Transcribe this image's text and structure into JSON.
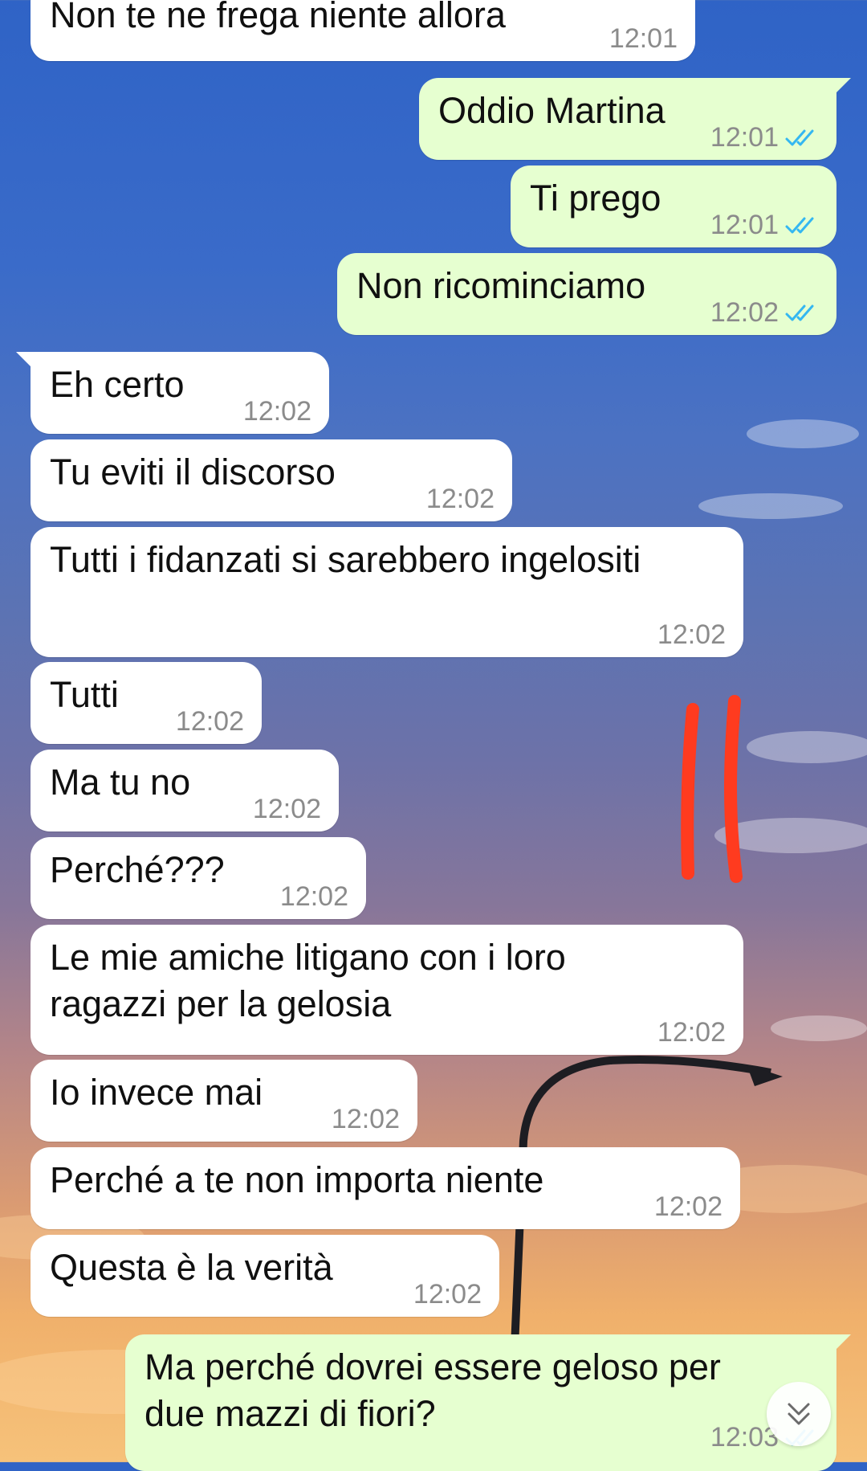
{
  "messages": [
    {
      "text": "Non te ne frega niente allora",
      "time": "12:01",
      "side": "in"
    },
    {
      "text": "Oddio Martina",
      "time": "12:01",
      "side": "out"
    },
    {
      "text": "Ti prego",
      "time": "12:01",
      "side": "out"
    },
    {
      "text": "Non ricominciamo",
      "time": "12:02",
      "side": "out"
    },
    {
      "text": "Eh certo",
      "time": "12:02",
      "side": "in"
    },
    {
      "text": "Tu eviti il discorso",
      "time": "12:02",
      "side": "in"
    },
    {
      "text": "Tutti i fidanzati si sarebbero ingelositi",
      "time": "12:02",
      "side": "in"
    },
    {
      "text": "Tutti",
      "time": "12:02",
      "side": "in"
    },
    {
      "text": "Ma tu no",
      "time": "12:02",
      "side": "in"
    },
    {
      "text": "Perché???",
      "time": "12:02",
      "side": "in"
    },
    {
      "text": "Le mie amiche litigano con i loro ragazzi per la gelosia",
      "time": "12:02",
      "side": "in"
    },
    {
      "text": "Io invece mai",
      "time": "12:02",
      "side": "in"
    },
    {
      "text": "Perché a te non importa niente",
      "time": "12:02",
      "side": "in"
    },
    {
      "text": "Questa è la verità",
      "time": "12:02",
      "side": "in"
    },
    {
      "text": "Ma perché dovrei essere geloso per due mazzi di fiori?",
      "time": "12:03",
      "side": "out"
    }
  ],
  "icons": {
    "read_receipt": "double-check-icon",
    "scroll_down": "double-chevron-down-icon",
    "annotation": "red-marker-lines"
  },
  "colors": {
    "incoming_bubble": "#ffffff",
    "outgoing_bubble": "#e6ffd0",
    "read_tick": "#34b7f1",
    "annotation_red": "#ff3b1f"
  }
}
